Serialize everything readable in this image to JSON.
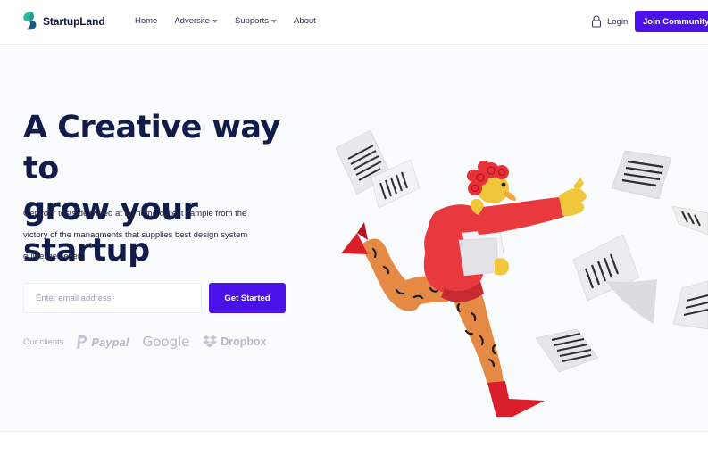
{
  "brand": {
    "name": "StartupLand",
    "logo_icon": "leaf-s-icon",
    "accent": "#4a11e8",
    "title_color": "#121c4a"
  },
  "nav": {
    "items": [
      {
        "label": "Home",
        "dropdown": false
      },
      {
        "label": "Adversite",
        "dropdown": true
      },
      {
        "label": "Supports",
        "dropdown": true
      },
      {
        "label": "About",
        "dropdown": false
      }
    ],
    "login_label": "Login",
    "login_icon": "lock-icon",
    "join_label": "Join Community"
  },
  "hero": {
    "title_line1": "A Creative way to",
    "title_line2": "grow your startup",
    "description_line1": "Get your tests delivered at let home collect sample from the",
    "description_line2": "victory of the managments that supplies best design system",
    "description_line3": "guidelines ever.",
    "email_placeholder": "Enter email address",
    "cta_label": "Get Started",
    "clients_label": "Our clients",
    "clients": [
      {
        "name": "Paypal",
        "icon": "paypal-icon"
      },
      {
        "name": "Google",
        "icon": ""
      },
      {
        "name": "Dropbox",
        "icon": "dropbox-icon"
      }
    ],
    "illustration": "running-man-with-flying-papers"
  }
}
